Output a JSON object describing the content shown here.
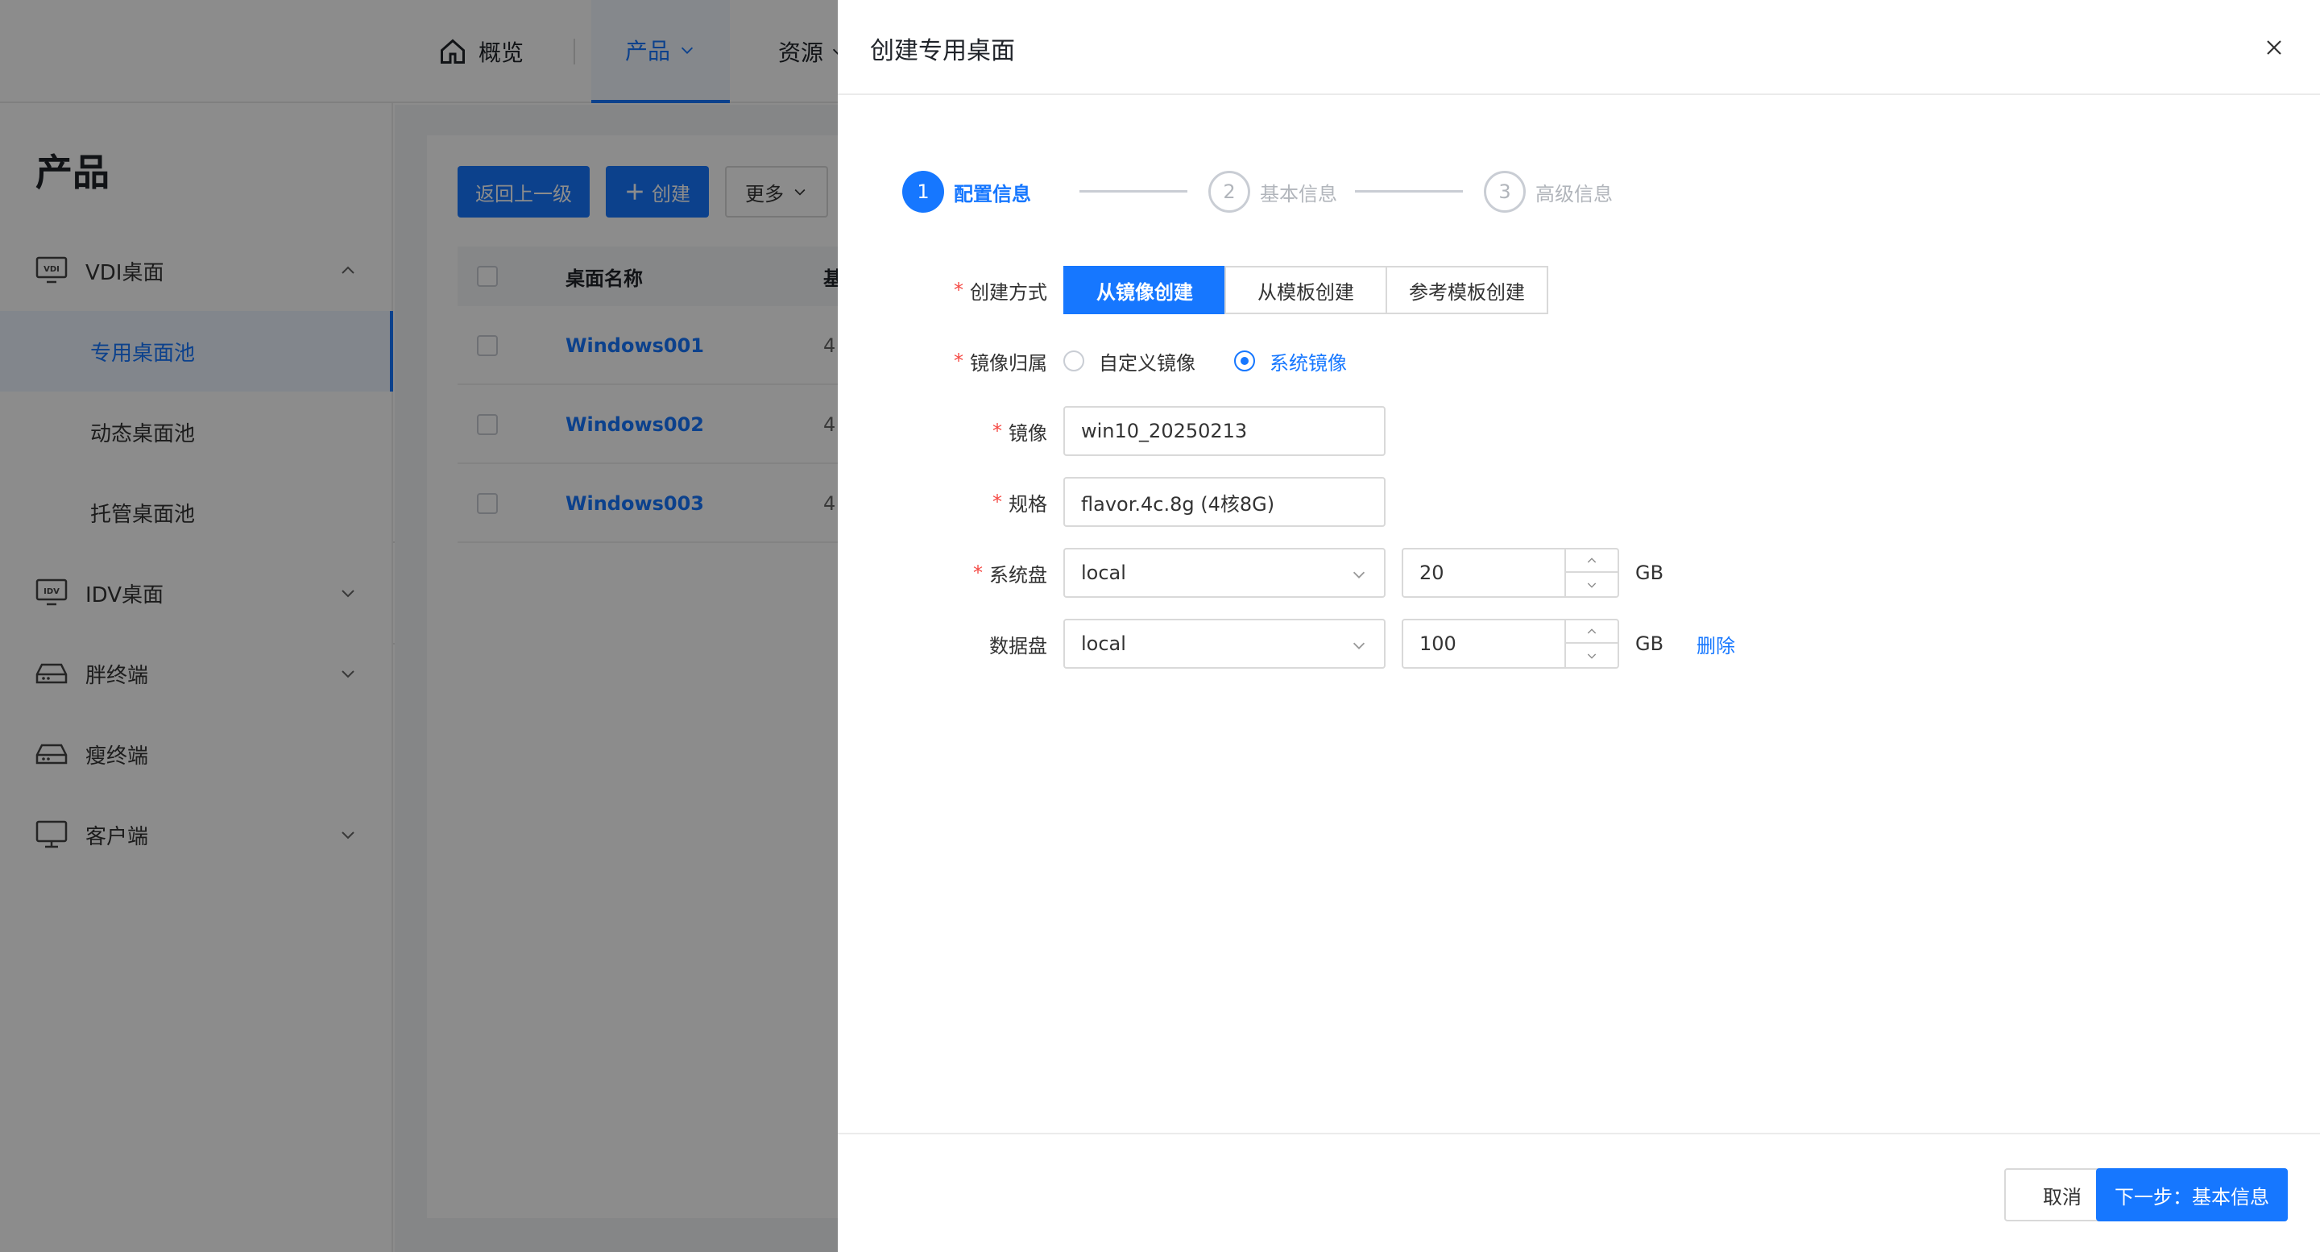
{
  "topnav": {
    "items": [
      {
        "label": "概览"
      },
      {
        "label": "产品"
      },
      {
        "label": "资源"
      }
    ]
  },
  "sidebar": {
    "title": "产品",
    "vdi": {
      "label": "VDI桌面",
      "icon_text": "VDI"
    },
    "vdi_subitems": [
      {
        "label": "专用桌面池"
      },
      {
        "label": "动态桌面池"
      },
      {
        "label": "托管桌面池"
      }
    ],
    "idv": {
      "label": "IDV桌面",
      "icon_text": "IDV"
    },
    "fat_terminal": {
      "label": "胖终端"
    },
    "thin_terminal": {
      "label": "瘦终端"
    },
    "client": {
      "label": "客户端"
    }
  },
  "toolbar": {
    "back_label": "返回上一级",
    "create_label": "创建",
    "more_label": "更多"
  },
  "table": {
    "columns": [
      "桌面名称",
      "基"
    ],
    "rows": [
      {
        "name": "Windows001",
        "c2": "4"
      },
      {
        "name": "Windows002",
        "c2": "4"
      },
      {
        "name": "Windows003",
        "c2": "4"
      }
    ]
  },
  "drawer": {
    "title": "创建专用桌面",
    "steps": [
      {
        "num": "1",
        "label": "配置信息"
      },
      {
        "num": "2",
        "label": "基本信息"
      },
      {
        "num": "3",
        "label": "高级信息"
      }
    ],
    "form": {
      "create_method_label": "创建方式",
      "create_methods": [
        "从镜像创建",
        "从模板创建",
        "参考模板创建"
      ],
      "image_owner_label": "镜像归属",
      "image_owner_options": [
        "自定义镜像",
        "系统镜像"
      ],
      "image_label": "镜像",
      "image_value": "win10_20250213",
      "flavor_label": "规格",
      "flavor_value": "flavor.4c.8g (4核8G)",
      "system_disk_label": "系统盘",
      "system_disk_type": "local",
      "system_disk_size": "20",
      "data_disk_label": "数据盘",
      "data_disk_type": "local",
      "data_disk_size": "100",
      "unit": "GB",
      "delete_label": "删除"
    },
    "footer": {
      "cancel_label": "取消",
      "next_label": "下一步：基本信息"
    }
  },
  "colors": {
    "primary": "#1677ff",
    "required": "#f54a45"
  }
}
